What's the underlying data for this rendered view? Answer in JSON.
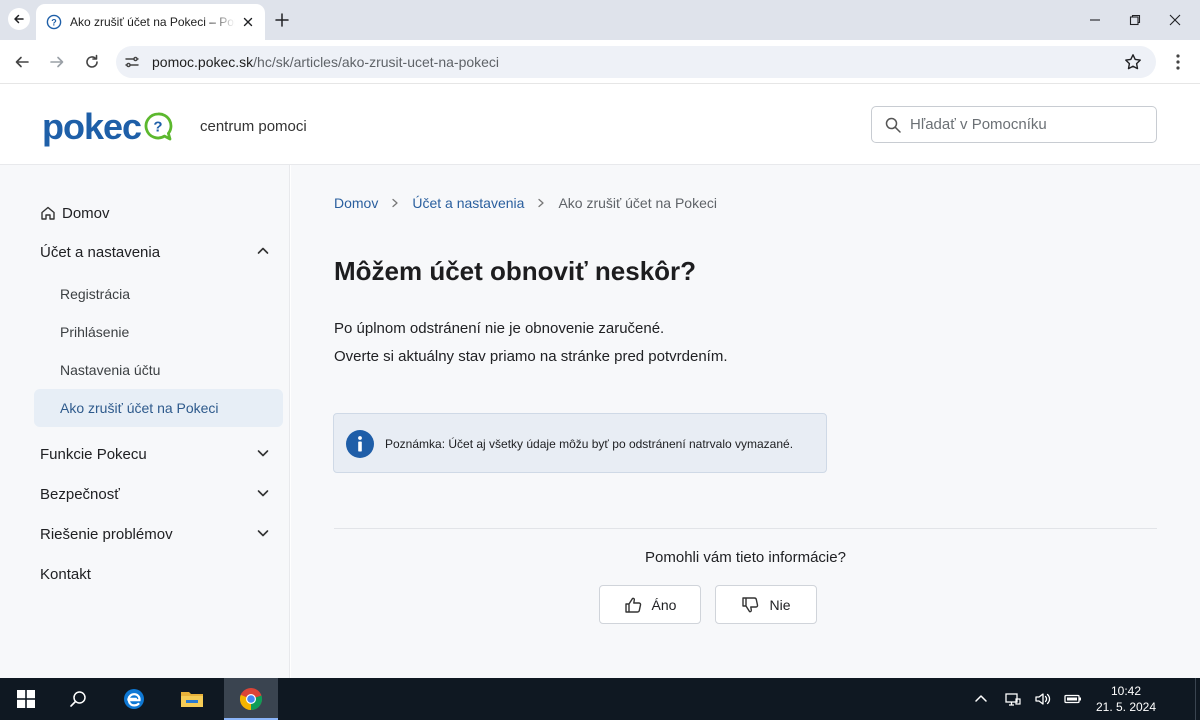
{
  "browser": {
    "tab_title": "Ako zrušiť účet na Pokeci – Pomoc",
    "url_host": "pomoc.pokec.sk",
    "url_path": "/hc/sk/articles/ako-zrusit-ucet-na-pokeci"
  },
  "header": {
    "logo_text": "pokec",
    "subtitle": "centrum pomoci",
    "search_placeholder": "Hľadať v Pomocníku"
  },
  "sidebar": {
    "home": "Domov",
    "groups": [
      {
        "label": "Účet a nastavenia",
        "expanded": true,
        "items": [
          "Registrácia",
          "Prihlásenie",
          "Nastavenia účtu",
          "Ako zrušiť účet na Pokeci"
        ],
        "active": "Ako zrušiť účet na Pokeci"
      },
      {
        "label": "Funkcie Pokecu",
        "expanded": false
      },
      {
        "label": "Bezpečnosť",
        "expanded": false
      },
      {
        "label": "Riešenie problémov",
        "expanded": false
      }
    ],
    "contact": "Kontakt"
  },
  "breadcrumb": [
    "Domov",
    "Účet a nastavenia",
    "Ako zrušiť účet na Pokeci"
  ],
  "article": {
    "title": "Môžem účet obnoviť neskôr?",
    "paragraphs": [
      "Po úplnom odstránení nie je obnovenie zaručené.",
      "Overte si aktuálny stav priamo na stránke pred potvrdením."
    ],
    "note": "Poznámka: Účet aj všetky údaje môžu byť po odstránení natrvalo vymazané."
  },
  "feedback": {
    "question": "Pomohli vám tieto informácie?",
    "yes": "Áno",
    "no": "Nie"
  },
  "taskbar": {
    "time": "10:42",
    "date": "21. 5. 2024"
  },
  "colors": {
    "brand_blue": "#1e5fa8",
    "brand_green": "#5cb82e",
    "link": "#2a5f9e",
    "note_bg": "#e8edf4",
    "info_icon": "#1f5ea8"
  },
  "icons": [
    "back-icon",
    "chrome-favicon",
    "close-icon",
    "plus-icon",
    "minimize-icon",
    "restore-icon",
    "arrow-left-icon",
    "arrow-right-icon",
    "reload-icon",
    "tune-icon",
    "star-icon",
    "more-icon",
    "search-icon",
    "home-icon",
    "chevron-up-icon",
    "chevron-down-icon",
    "info-icon",
    "thumbs-up-icon",
    "thumbs-down-icon",
    "windows-icon",
    "edge-icon",
    "folder-icon",
    "chrome-icon"
  ]
}
